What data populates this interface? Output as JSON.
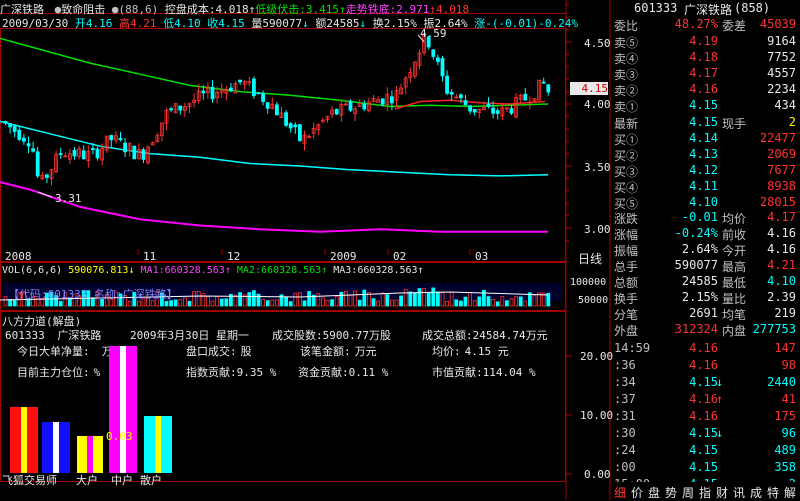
{
  "header": {
    "stock_name": "广深铁路",
    "indicator_name": "致命阻击",
    "indicator_params": "(88,6)",
    "cost_label": "控盘成本:",
    "cost_value": "4.018",
    "support_label": "低级伏击:",
    "support_value": "3.415",
    "bottom_label": "走势铁底:",
    "bottom_value": "2.971",
    "last_value": "4.018"
  },
  "quote_line": {
    "date": "2009/03/30",
    "open_label": "开",
    "open": "4.16",
    "high_label": "高",
    "high": "4.21",
    "low_label": "低",
    "low": "4.10",
    "close_label": "收",
    "close": "4.15",
    "volume_label": "量",
    "volume": "590077",
    "amount_label": "额",
    "amount": "24585",
    "turnover_label": "换",
    "turnover": "2.15%",
    "amplitude_label": "振",
    "amplitude": "2.64%",
    "change_label": "涨",
    "change": "-(-0.01)-0.24%"
  },
  "price_axis": [
    "4.50",
    "4.00",
    "3.50",
    "3.00"
  ],
  "price_tag": "4.15",
  "peak_label": "4.59",
  "trough_label": "3.31",
  "time_axis": [
    "2008",
    "11",
    "12",
    "2009",
    "02",
    "03"
  ],
  "daily_tab": "日线",
  "volume_header": {
    "vol_label": "VOL(6,6,6)",
    "vol": "590076.813",
    "ma1": "MA1:660328.563",
    "ma2": "MA2:660328.563",
    "ma3": "MA3:660328.563"
  },
  "volume_axis": [
    "100000",
    "50000"
  ],
  "code_banner": "【代码:601333 名称:广深铁路】",
  "lower_panel": {
    "title": "八方力道(解盘)",
    "code": "601333",
    "name": "广深铁路",
    "date": "2009年3月30日  星期一",
    "traded_shares_label": "成交股数:",
    "traded_shares": "5900.77万股",
    "traded_amount_label": "成交总额:",
    "traded_amount": "24584.74万元",
    "net_buy_label": "今日大单净量:",
    "net_buy_value": "万股",
    "deal_label": "盘口成交:",
    "deal_value": "股",
    "deal_amount_label": "该笔金额:",
    "deal_amount_value": "万元",
    "avg_price_label": "均价:",
    "avg_price_value": "4.15 元",
    "position_label": "目前主力仓位:",
    "position_value": "%",
    "index_contrib_label": "指数贡献:",
    "index_contrib_value": "9.35 %",
    "fund_contrib_label": "资金贡献:",
    "fund_contrib_value": "0.11 %",
    "mkt_contrib_label": "市值贡献:",
    "mkt_contrib_value": "114.04 %",
    "bar_value_label": "0.03",
    "axis": [
      "20.00",
      "10.00",
      "0.00"
    ],
    "groups": [
      "飞狐交易师",
      "大户",
      "中户",
      "散户"
    ]
  },
  "right_panel": {
    "code": "601333",
    "name": "广深铁路",
    "count": "(858)",
    "ratio_label": "委比",
    "ratio": "48.27%",
    "diff_label": "委差",
    "diff": "45039",
    "asks": [
      {
        "label": "卖⑤",
        "price": "4.19",
        "vol": "9164"
      },
      {
        "label": "卖④",
        "price": "4.18",
        "vol": "7752"
      },
      {
        "label": "卖③",
        "price": "4.17",
        "vol": "4557"
      },
      {
        "label": "卖②",
        "price": "4.16",
        "vol": "2234"
      },
      {
        "label": "卖①",
        "price": "4.15",
        "vol": "434"
      }
    ],
    "last_label": "最新",
    "last": "4.15",
    "hand_label": "现手",
    "hand": "2",
    "bids": [
      {
        "label": "买①",
        "price": "4.14",
        "vol": "22477"
      },
      {
        "label": "买②",
        "price": "4.13",
        "vol": "2069"
      },
      {
        "label": "买③",
        "price": "4.12",
        "vol": "7677"
      },
      {
        "label": "买④",
        "price": "4.11",
        "vol": "8938"
      },
      {
        "label": "买⑤",
        "price": "4.10",
        "vol": "28015"
      }
    ],
    "stats": [
      {
        "l1": "涨跌",
        "v1": "-0.01",
        "l2": "均价",
        "v2": "4.17"
      },
      {
        "l1": "涨幅",
        "v1": "-0.24%",
        "l2": "前收",
        "v2": "4.16"
      },
      {
        "l1": "振幅",
        "v1": "2.64%",
        "l2": "今开",
        "v2": "4.16"
      },
      {
        "l1": "总手",
        "v1": "590077",
        "l2": "最高",
        "v2": "4.21"
      },
      {
        "l1": "总额",
        "v1": "24585",
        "l2": "最低",
        "v2": "4.10"
      },
      {
        "l1": "换手",
        "v1": "2.15%",
        "l2": "量比",
        "v2": "2.39"
      },
      {
        "l1": "分笔",
        "v1": "2691",
        "l2": "均笔",
        "v2": "219"
      }
    ],
    "outer_label": "外盘",
    "outer": "312324",
    "inner_label": "内盘",
    "inner": "277753",
    "ticks": [
      {
        "time": "14:59",
        "price": "4.16",
        "arrow": "",
        "vol": "147",
        "color": "red"
      },
      {
        "time": ":36",
        "price": "4.16",
        "arrow": "",
        "vol": "98",
        "color": "red"
      },
      {
        "time": ":34",
        "price": "4.15",
        "arrow": "↓",
        "vol": "2440",
        "color": "cyan"
      },
      {
        "time": ":37",
        "price": "4.16",
        "arrow": "↑",
        "vol": "41",
        "color": "red"
      },
      {
        "time": ":31",
        "price": "4.16",
        "arrow": "",
        "vol": "175",
        "color": "red"
      },
      {
        "time": ":30",
        "price": "4.15",
        "arrow": "↓",
        "vol": "96",
        "color": "cyan"
      },
      {
        "time": ":24",
        "price": "4.15",
        "arrow": "",
        "vol": "489",
        "color": "cyan"
      },
      {
        "time": ":00",
        "price": "4.15",
        "arrow": "",
        "vol": "358",
        "color": "cyan"
      },
      {
        "time": "15:00",
        "price": "4.15",
        "arrow": "",
        "vol": "2",
        "color": "cyan"
      }
    ],
    "bottom_tabs": [
      "细",
      "价",
      "盘",
      "势",
      "周",
      "指",
      "财",
      "讯",
      "成",
      "特",
      "解"
    ]
  },
  "colors": {
    "up": "#ff3232",
    "down": "#00ffff",
    "ma_green": "#00e000",
    "ma_red": "#ff2020",
    "ma_cyan": "#00ffff",
    "ma_magenta": "#ff00ff",
    "grid": "#a00000"
  }
}
